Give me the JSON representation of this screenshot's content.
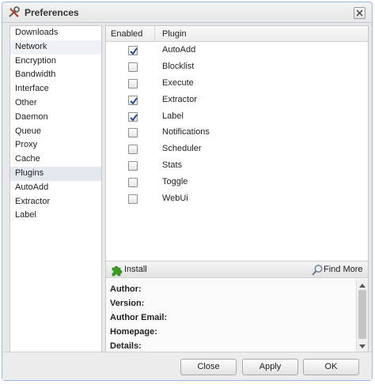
{
  "window": {
    "title": "Preferences"
  },
  "sidebar": {
    "items": [
      {
        "label": "Downloads"
      },
      {
        "label": "Network"
      },
      {
        "label": "Encryption"
      },
      {
        "label": "Bandwidth"
      },
      {
        "label": "Interface"
      },
      {
        "label": "Other"
      },
      {
        "label": "Daemon"
      },
      {
        "label": "Queue"
      },
      {
        "label": "Proxy"
      },
      {
        "label": "Cache"
      },
      {
        "label": "Plugins"
      },
      {
        "label": "AutoAdd"
      },
      {
        "label": "Extractor"
      },
      {
        "label": "Label"
      }
    ],
    "selected": "Plugins"
  },
  "plugins": {
    "columns": {
      "enabled": "Enabled",
      "plugin": "Plugin"
    },
    "rows": [
      {
        "name": "AutoAdd",
        "enabled": true
      },
      {
        "name": "Blocklist",
        "enabled": false
      },
      {
        "name": "Execute",
        "enabled": false
      },
      {
        "name": "Extractor",
        "enabled": true
      },
      {
        "name": "Label",
        "enabled": true
      },
      {
        "name": "Notifications",
        "enabled": false
      },
      {
        "name": "Scheduler",
        "enabled": false
      },
      {
        "name": "Stats",
        "enabled": false
      },
      {
        "name": "Toggle",
        "enabled": false
      },
      {
        "name": "WebUi",
        "enabled": false
      }
    ]
  },
  "toolbar": {
    "install_label": "Install",
    "find_more_label": "Find More"
  },
  "details": {
    "author_label": "Author:",
    "version_label": "Version:",
    "author_email_label": "Author Email:",
    "homepage_label": "Homepage:",
    "details_label": "Details:"
  },
  "footer": {
    "close_label": "Close",
    "apply_label": "Apply",
    "ok_label": "OK"
  },
  "colors": {
    "window_border": "#99bbe8",
    "checkmark": "#1d3f8a",
    "install_icon": "#3a9d23"
  }
}
